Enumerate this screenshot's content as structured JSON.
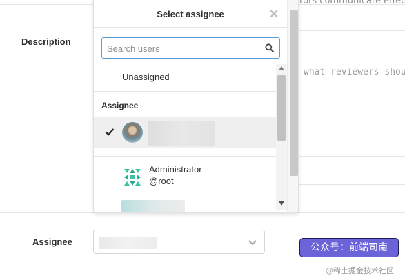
{
  "background": {
    "top_text": "tors communicate effecti",
    "description_label": "Description",
    "description_placeholder": "what reviewers shou",
    "assignee_label": "Assignee"
  },
  "dropdown": {
    "title": "Select assignee",
    "search_placeholder": "Search users",
    "unassigned_label": "Unassigned",
    "section_header": "Assignee",
    "users": [
      {
        "name": "Administrator",
        "username": "@root"
      }
    ]
  },
  "overlay": {
    "badge": "公众号：前端司南",
    "watermark": "@稀土掘金技术社区"
  },
  "icons": {
    "close": "close-icon",
    "search": "search-icon",
    "check": "check-icon",
    "chevron": "chevron-down-icon"
  },
  "colors": {
    "accent_focus": "#5c9dd9",
    "badge_bg": "#6b63d8",
    "selected_row": "#efefef"
  }
}
